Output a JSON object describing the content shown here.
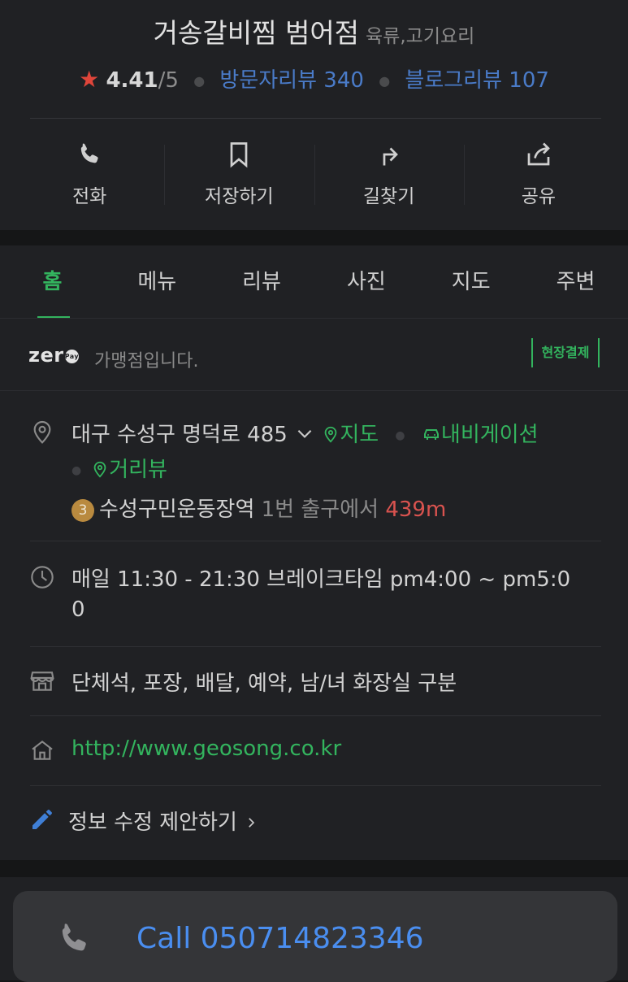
{
  "header": {
    "title": "거송갈비찜 범어점",
    "category": "육류,고기요리",
    "rating": "4.41",
    "rating_max": "/5",
    "visitor_reviews": "방문자리뷰 340",
    "blog_reviews": "블로그리뷰 107"
  },
  "actions": {
    "call": "전화",
    "save": "저장하기",
    "directions": "길찾기",
    "share": "공유"
  },
  "tabs": [
    "홈",
    "메뉴",
    "리뷰",
    "사진",
    "지도",
    "주변"
  ],
  "zero_pay": {
    "logo_text": "zer",
    "logo_pay": "Pay",
    "text": "가맹점입니다.",
    "badge": "현장결제"
  },
  "info": {
    "address": "대구 수성구 명덕로 485",
    "map_link": "지도",
    "navigation_link": "내비게이션",
    "street_view_link": "거리뷰",
    "subway_line": "3",
    "station": "수성구민운동장역",
    "exit_text": "1번 출구에서",
    "distance": "439m",
    "hours_line1": "매일 11:30 - 21:30 브레이크타임 pm4:00 ~ pm5:0",
    "hours_line2": "0",
    "amenities": "단체석, 포장, 배달, 예약, 남/녀 화장실 구분",
    "website": "http://www.geosong.co.kr",
    "edit_suggestion": "정보 수정 제안하기"
  },
  "call_sheet": {
    "label": "Call 050714823346"
  },
  "colors": {
    "accent_green": "#33b45e",
    "link_blue": "#4a7bc8",
    "distance_red": "#d9534f",
    "call_blue": "#4a8ef0"
  }
}
